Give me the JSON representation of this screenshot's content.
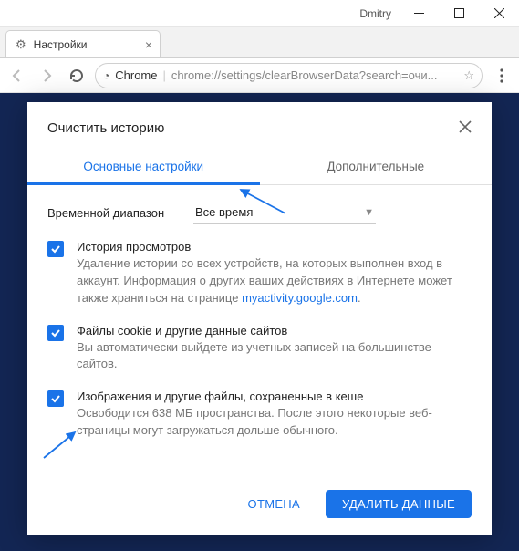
{
  "window": {
    "user": "Dmitry"
  },
  "tab": {
    "title": "Настройки"
  },
  "url": {
    "origin": "Chrome",
    "path": "chrome://settings/clearBrowserData?search=очи..."
  },
  "dialog": {
    "title": "Очистить историю",
    "tabs": {
      "basic": "Основные настройки",
      "advanced": "Дополнительные"
    },
    "time_label": "Временной диапазон",
    "time_value": "Все время",
    "options": [
      {
        "title": "История просмотров",
        "desc_a": "Удаление истории со всех устройств, на которых выполнен вход в аккаунт. Информация о других ваших действиях в Интернете может также храниться на странице ",
        "link": "myactivity.google.com",
        "desc_b": "."
      },
      {
        "title": "Файлы cookie и другие данные сайтов",
        "desc_a": "Вы автоматически выйдете из учетных записей на большинстве сайтов.",
        "link": "",
        "desc_b": ""
      },
      {
        "title": "Изображения и другие файлы, сохраненные в кеше",
        "desc_a": "Освободится 638 МБ пространства. После этого некоторые веб-страницы могут загружаться дольше обычного.",
        "link": "",
        "desc_b": ""
      }
    ],
    "buttons": {
      "cancel": "ОТМЕНА",
      "clear": "УДАЛИТЬ ДАННЫЕ"
    }
  }
}
